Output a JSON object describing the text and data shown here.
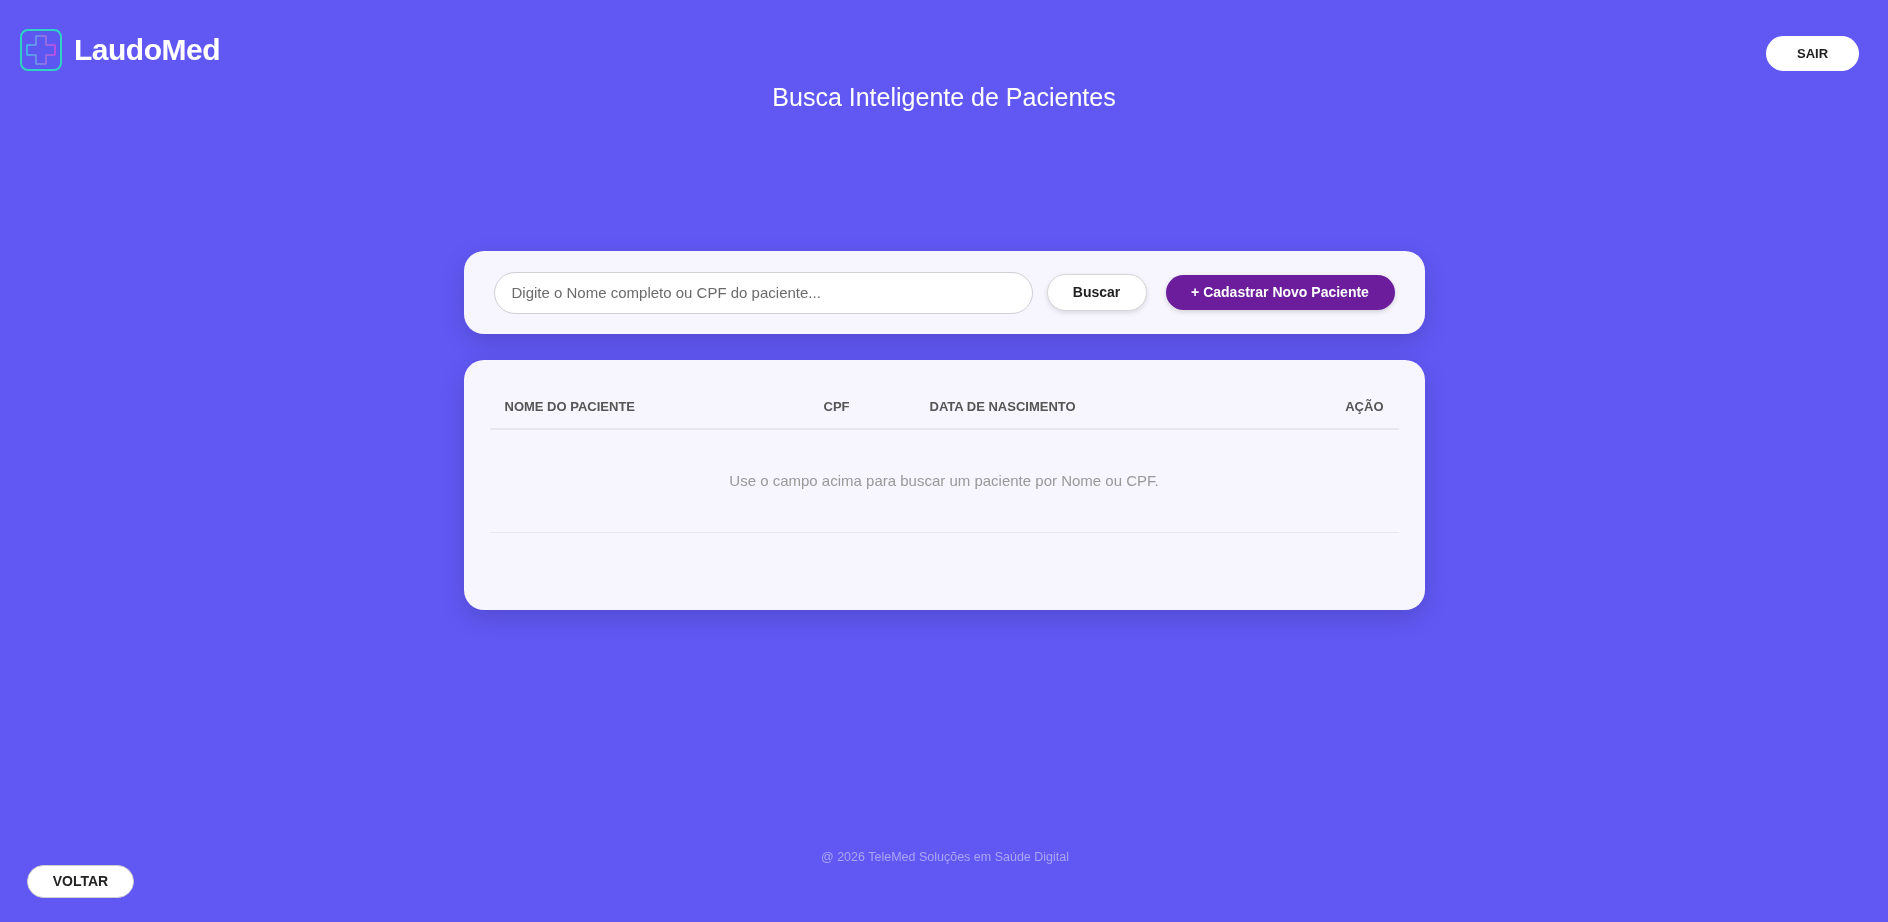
{
  "header": {
    "logo": {
      "text": "LaudoMed"
    },
    "logout_button": "SAIR",
    "title": "Busca Inteligente de Pacientes"
  },
  "search": {
    "placeholder": "Digite o Nome completo ou CPF do paciente...",
    "search_button": "Buscar",
    "new_patient_button": "+ Cadastrar Novo Paciente"
  },
  "table": {
    "columns": [
      "NOME DO PACIENTE",
      "CPF",
      "DATA DE NASCIMENTO",
      "AÇÃO"
    ],
    "empty_message": "Use o campo acima para buscar um paciente por Nome ou CPF."
  },
  "footer": {
    "copyright": "@ 2026 TeleMed Soluções em Saúde Digital",
    "back_button": "VOLTAR"
  }
}
